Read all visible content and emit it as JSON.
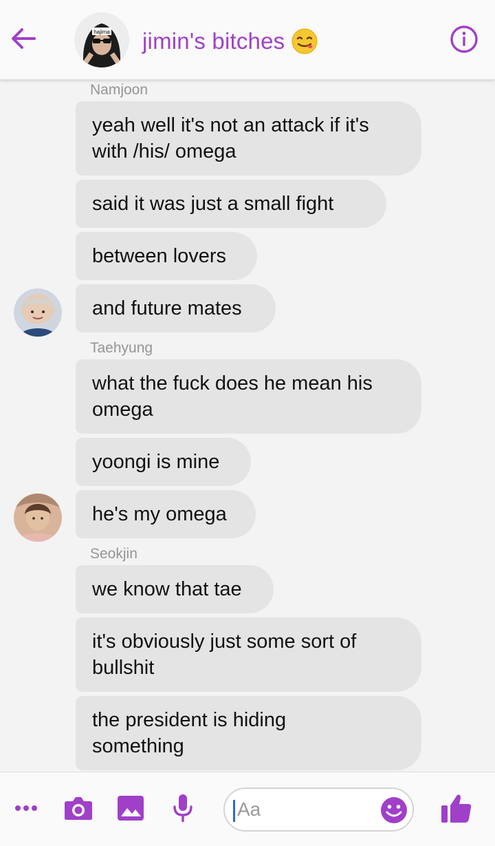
{
  "header": {
    "title": "jimin's bitches",
    "title_color": "#a040c8",
    "group_avatar_caption": "hajima",
    "icons": [
      "back-arrow-icon",
      "smirk-emoji-icon",
      "info-icon"
    ]
  },
  "messages": [
    {
      "sender": "Namjoon",
      "bubbles": [
        "yeah well it's not an attack if it's\nwith /his/ omega",
        "said it was just a small fight",
        "between lovers",
        "and future mates"
      ]
    },
    {
      "sender": "Taehyung",
      "bubbles": [
        "what the fuck does he mean his\nomega",
        "yoongi is mine",
        "he's my omega"
      ]
    },
    {
      "sender": "Seokjin",
      "bubbles": [
        "we know that tae",
        "it's obviously just some sort of\nbullshit",
        "the president is hiding\nsomething"
      ]
    }
  ],
  "composer": {
    "placeholder": "Aa",
    "icons": [
      "more-dots-icon",
      "camera-icon",
      "gallery-icon",
      "microphone-icon",
      "emoji-icon",
      "thumbs-up-icon"
    ],
    "accent_color": "#a040c8"
  },
  "colors": {
    "bubble": "#e4e4e4",
    "background": "#f3f3f3",
    "sender_label": "#959595"
  }
}
